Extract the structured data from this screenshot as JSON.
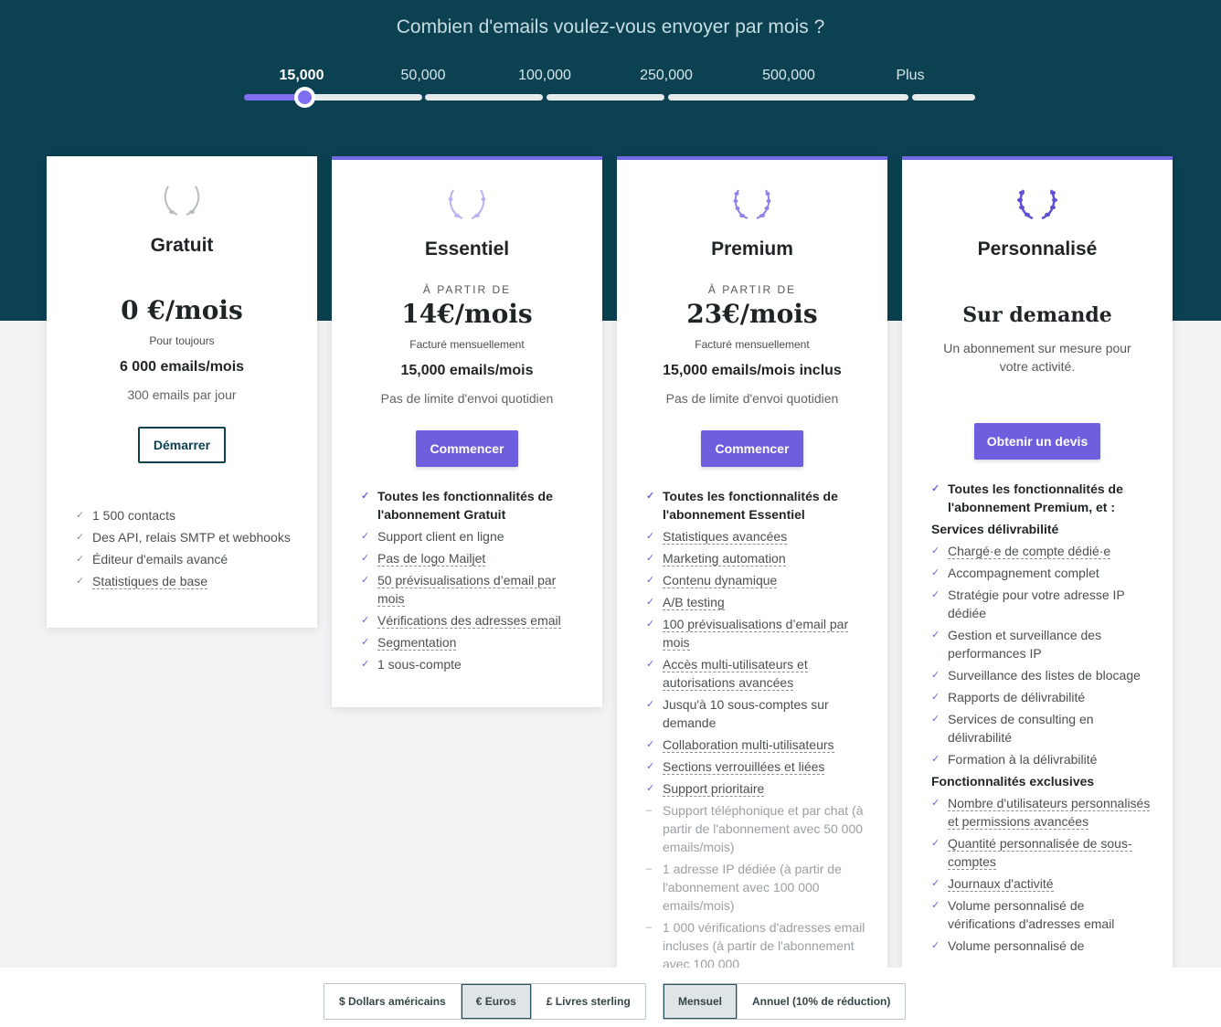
{
  "header": {
    "question": "Combien d'emails voulez-vous envoyer par mois ?",
    "slider": {
      "ticks": [
        "15,000",
        "50,000",
        "100,000",
        "250,000",
        "500,000",
        "Plus"
      ],
      "selected": "15,000"
    }
  },
  "colors": {
    "hero": "#0b4150",
    "accent": "#6d5fdd"
  },
  "plans": [
    {
      "title": "Gratuit",
      "from": "",
      "price": "0 €/mois",
      "billing": "Pour toujours",
      "volume": "6 000 emails/mois",
      "daily": "300 emails par jour",
      "cta": "Démarrer",
      "features": [
        "1 500 contacts",
        "Des API, relais SMTP et webhooks",
        "Éditeur d'emails avancé",
        "Statistiques de base"
      ]
    },
    {
      "title": "Essentiel",
      "from": "À PARTIR DE",
      "price": "14€/mois",
      "billing": "Facturé mensuellement",
      "volume": "15,000 emails/mois",
      "daily": "Pas de limite d'envoi quotidien",
      "cta": "Commencer",
      "features": [
        "Toutes les fonctionnalités de l'abonnement Gratuit",
        "Support client en ligne",
        "Pas de logo Mailjet",
        "50 prévisualisations d’email par mois",
        "Vérifications des adresses email",
        "Segmentation",
        "1 sous-compte"
      ]
    },
    {
      "title": "Premium",
      "from": "À PARTIR DE",
      "price": "23€/mois",
      "billing": "Facturé mensuellement",
      "volume": "15,000 emails/mois inclus",
      "daily": "Pas de limite d'envoi quotidien",
      "cta": "Commencer",
      "features": [
        "Toutes les fonctionnalités de l'abonnement Essentiel",
        "Statistiques avancées",
        "Marketing automation",
        "Contenu dynamique",
        "A/B testing",
        "100 prévisualisations d’email par mois",
        "Accès multi-utilisateurs et autorisations avancées",
        "Jusqu'à 10 sous-comptes sur demande",
        "Collaboration multi-utilisateurs",
        "Sections verrouillées et liées",
        "Support prioritaire",
        "Support téléphonique et par chat (à partir de l'abonnement avec 50 000 emails/mois)",
        "1 adresse IP dédiée (à partir de l'abonnement avec 100 000 emails/mois)",
        "1 000 vérifications d'adresses email incluses (à partir de l'abonnement avec 100 000"
      ]
    },
    {
      "title": "Personnalisé",
      "price": "Sur demande",
      "description": "Un abonnement sur mesure pour votre activité.",
      "cta": "Obtenir un devis",
      "features": [
        "Toutes les fonctionnalités de l'abonnement Premium, et :",
        "Services délivrabilité",
        "Chargé·e de compte dédié·e",
        "Accompagnement complet",
        "Stratégie pour votre adresse IP dédiée",
        "Gestion et surveillance des performances IP",
        "Surveillance des listes de blocage",
        "Rapports de délivrabilité",
        "Services de consulting en délivrabilité",
        "Formation à la délivrabilité",
        "Fonctionnalités exclusives",
        "Nombre d'utilisateurs personnalisés et permissions avancées",
        "Quantité personnalisée de sous-comptes",
        "Journaux d'activité",
        "Volume personnalisé de vérifications d'adresses email",
        "Volume personnalisé de"
      ]
    }
  ],
  "footer": {
    "currencies": [
      "$ Dollars américains",
      "€ Euros",
      "£ Livres sterling"
    ],
    "selected_currency": "€ Euros",
    "periods": [
      "Mensuel",
      "Annuel (10% de réduction)"
    ],
    "selected_period": "Mensuel"
  }
}
